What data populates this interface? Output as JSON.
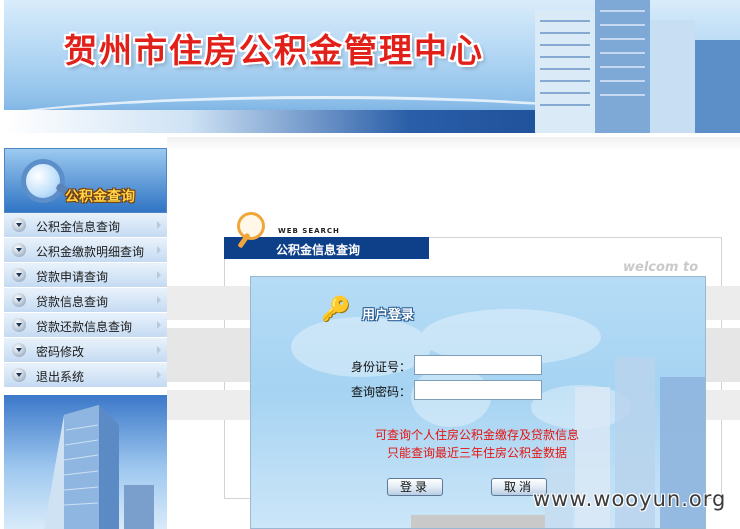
{
  "header": {
    "site_title": "贺州市住房公积金管理中心"
  },
  "sidebar": {
    "title": "公积金查询",
    "items": [
      {
        "label": "公积金信息查询"
      },
      {
        "label": "公积金缴款明细查询"
      },
      {
        "label": "贷款申请查询"
      },
      {
        "label": "贷款信息查询"
      },
      {
        "label": "贷款还款信息查询"
      },
      {
        "label": "密码修改"
      },
      {
        "label": "退出系统"
      }
    ]
  },
  "main": {
    "web_search_caption": "WEB SEARCH",
    "section_title": "公积金信息查询",
    "welcome_text": "welcom to"
  },
  "login": {
    "title": "用户登录",
    "id_label": "身份证号：",
    "id_value": "",
    "password_label": "查询密码：",
    "password_value": "",
    "notice_line1": "可查询个人住房公积金缴存及贷款信息",
    "notice_line2": "只能查询最近三年住房公积金数据",
    "login_button": "登录",
    "cancel_button": "取消"
  },
  "watermark": "www.wooyun.org",
  "colors": {
    "title_red": "#e2201a",
    "section_bar": "#0e3f89",
    "notice_red": "#e4130f"
  }
}
